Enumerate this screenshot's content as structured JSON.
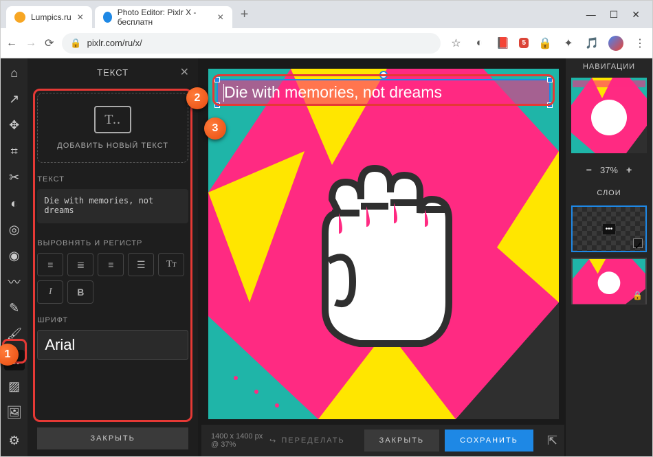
{
  "browser": {
    "tabs": [
      {
        "title": "Lumpics.ru",
        "icon_color": "#f7a623"
      },
      {
        "title": "Photo Editor: Pixlr X - бесплатн",
        "icon_color": "#1e88e5"
      }
    ],
    "url": "pixlr.com/ru/x/",
    "ext_badge": "5"
  },
  "panel": {
    "title": "ТЕКСТ",
    "add_text": "ДОБАВИТЬ НОВЫЙ ТЕКСТ",
    "text_label": "ТЕКСТ",
    "text_value": "Die with memories, not dreams",
    "align_label": "ВЫРОВНЯТЬ И РЕГИСТР",
    "font_label": "ШРИФТ",
    "font_value": "Arial",
    "close_btn": "ЗАКРЫТЬ"
  },
  "canvas": {
    "text": "Die with memories, not dreams",
    "dims": "1400 x 1400 px @ 37%"
  },
  "bottom": {
    "redo": "ПЕРЕДЕЛАТЬ",
    "close": "ЗАКРЫТЬ",
    "save": "СОХРАНИТЬ"
  },
  "right": {
    "nav_title": "НАВИГАЦИИ",
    "zoom": "37%",
    "layers_title": "СЛОИ"
  },
  "callouts": {
    "c1": "1",
    "c2": "2",
    "c3": "3"
  }
}
